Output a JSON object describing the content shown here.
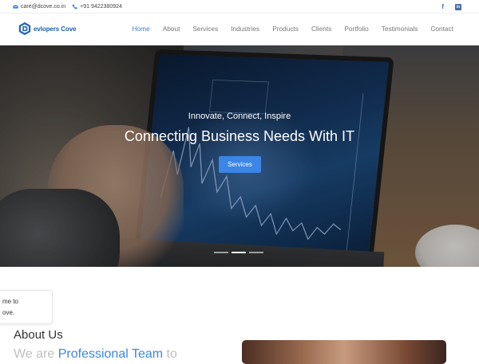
{
  "topbar": {
    "email": "care@dcove.co.in",
    "phone": "+91 9422380924",
    "social": [
      "f",
      "in"
    ]
  },
  "header": {
    "logo_text": "evlopers Cove",
    "nav": [
      {
        "label": "Home",
        "active": true
      },
      {
        "label": "About"
      },
      {
        "label": "Services"
      },
      {
        "label": "Industries"
      },
      {
        "label": "Products"
      },
      {
        "label": "Clients"
      },
      {
        "label": "Portfolio"
      },
      {
        "label": "Testimonials"
      },
      {
        "label": "Contact"
      }
    ]
  },
  "hero": {
    "subtitle": "Innovate, Connect, Inspire",
    "title": "Connecting Business Needs With IT",
    "button": "Services",
    "slides": 3,
    "active_slide": 2
  },
  "welcome": {
    "line1": "me to",
    "line2": "ove."
  },
  "about": {
    "title": "About Us",
    "sub_prefix": "We are ",
    "sub_highlight": "Professional Team",
    "sub_suffix": " to"
  },
  "colors": {
    "accent": "#3b86e6",
    "logo": "#1d5fa8"
  }
}
